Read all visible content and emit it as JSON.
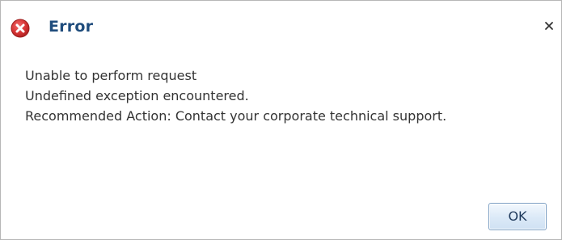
{
  "dialog": {
    "title": "Error",
    "icon": "error-icon",
    "close_icon": "close-icon",
    "messages": [
      "Unable to perform request",
      "Undefined exception encountered.",
      "Recommended Action: Contact your corporate technical support."
    ],
    "ok_label": "OK"
  },
  "colors": {
    "title": "#1f4c7c",
    "error_icon": "#d63333",
    "text": "#333333",
    "button_border": "#7ea0c4"
  }
}
